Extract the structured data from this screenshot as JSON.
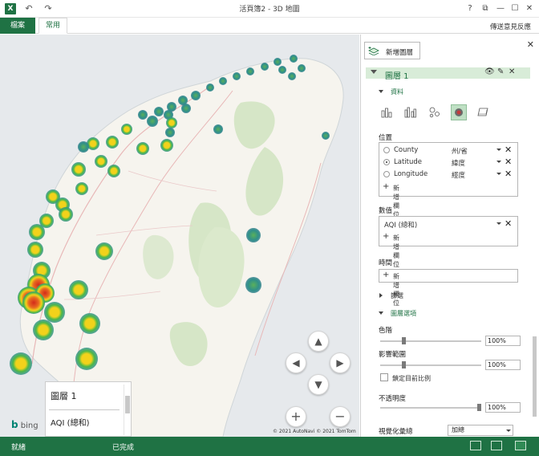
{
  "titlebar": {
    "app_icon": "X",
    "undo_icon": "undo-icon",
    "redo_icon": "redo-icon",
    "title": "活頁簿2 - 3D 地圖",
    "help": "?",
    "restore_icon": "restore-icon",
    "minimize_icon": "minimize-icon",
    "maximize_icon": "maximize-icon",
    "close_icon": "close-icon"
  },
  "ribbon": {
    "file_tab": "檔案",
    "home_tab": "常用",
    "feedback": "傳送意見反應"
  },
  "map": {
    "bing_label": "bing",
    "copyright": "© 2021 AutoNavi  © 2021 TomTom",
    "legend": {
      "title": "圖層 1",
      "subtitle": "AQI (總和)"
    },
    "nav": {
      "up": "▲",
      "down": "▼",
      "left": "◀",
      "right": "▶",
      "zoom_in": "+",
      "zoom_out": "−"
    }
  },
  "panel": {
    "add_layer": "新增圖層",
    "layer_name": "圖層 1",
    "sections": {
      "data": "資料",
      "filters": "篩選",
      "layer_options": "圖層選項"
    },
    "location": {
      "title": "位置",
      "rows": [
        {
          "name": "County",
          "type": "州/省",
          "selected": false
        },
        {
          "name": "Latitude",
          "type": "緯度",
          "selected": true
        },
        {
          "name": "Longitude",
          "type": "經度",
          "selected": false
        }
      ],
      "add_field": "新增欄位"
    },
    "value": {
      "title": "數值",
      "field": "AQI (總和)",
      "add_field": "新增欄位"
    },
    "time": {
      "title": "時間",
      "add_field": "新增欄位"
    },
    "options": {
      "color_scale_label": "色階",
      "color_scale_value": "100%",
      "color_scale_fraction": 0.22,
      "radius_label": "影響範圍",
      "radius_value": "100%",
      "radius_fraction": 0.22,
      "lock_scale_label": "鎖定目前比例",
      "opacity_label": "不透明度",
      "opacity_value": "100%",
      "opacity_fraction": 1.0,
      "aggregation_label": "視覺化彙總",
      "aggregation_value": "加總"
    }
  },
  "statusbar": {
    "ready": "就緒",
    "done": "已完成"
  },
  "colors": {
    "accent": "#1f7244",
    "heat_red": "#e0301e",
    "heat_yellow": "#f2d21b",
    "heat_green": "#4cb847",
    "heat_teal": "#2f8f8a"
  }
}
